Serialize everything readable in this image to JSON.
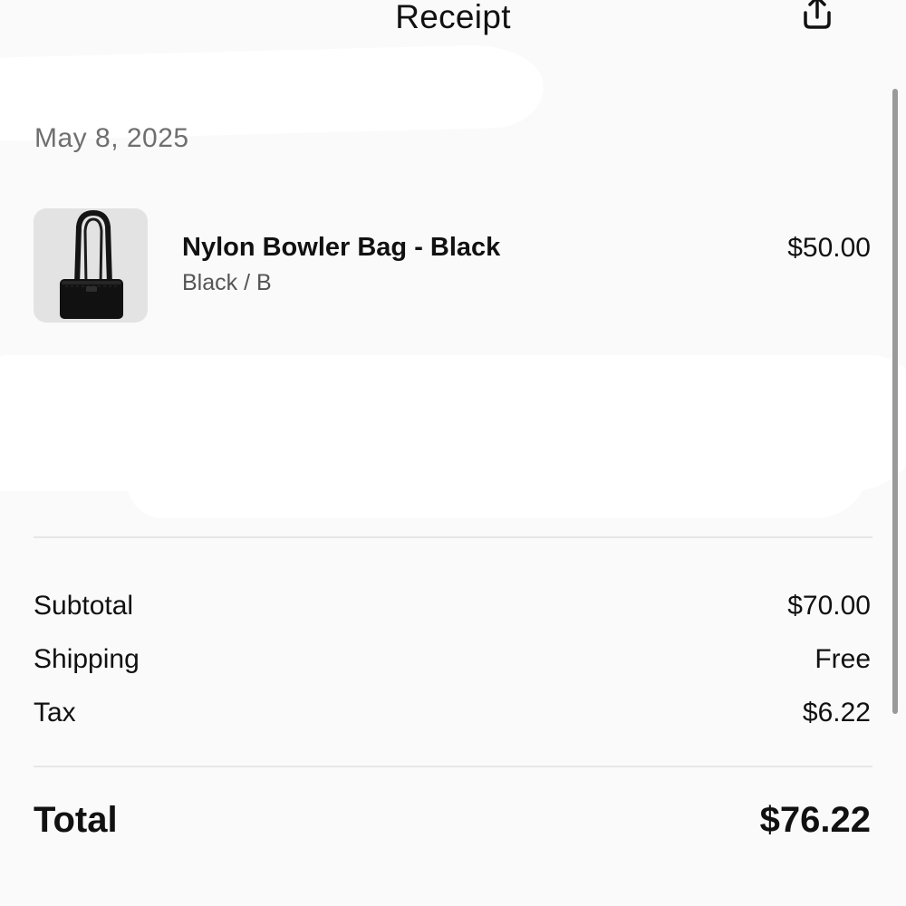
{
  "header": {
    "title": "Receipt",
    "share_icon": "share-upload-icon"
  },
  "order": {
    "date": "May 8, 2025"
  },
  "items": [
    {
      "name": "Nylon Bowler Bag - Black",
      "variant": "Black / B",
      "price": "$50.00",
      "thumbnail_icon": "black-bowler-bag-image"
    }
  ],
  "summary": {
    "subtotal_label": "Subtotal",
    "subtotal_value": "$70.00",
    "shipping_label": "Shipping",
    "shipping_value": "Free",
    "tax_label": "Tax",
    "tax_value": "$6.22",
    "total_label": "Total",
    "total_value": "$76.22"
  },
  "colors": {
    "background": "#fafafa",
    "text_primary": "#111111",
    "text_secondary": "#6f6f6f",
    "divider": "#e6e6e6",
    "thumbnail_bg": "#e3e3e3"
  }
}
